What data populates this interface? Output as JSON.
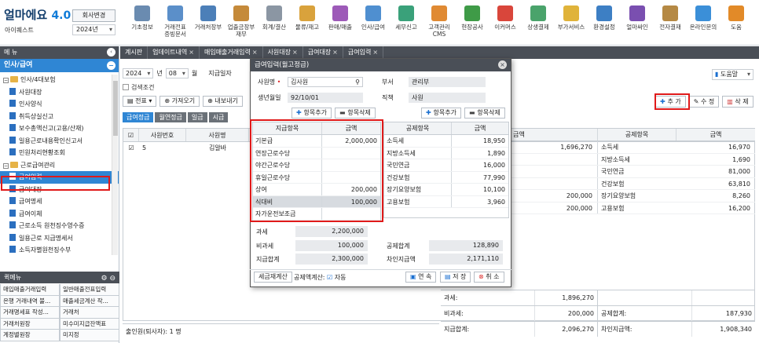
{
  "app": {
    "logo": "얼마에요",
    "version": "4.0",
    "company": "아이퀘스트",
    "company_change": "회사변경",
    "year": "2024년"
  },
  "toolbar": [
    {
      "label": "기초정보",
      "icon": "basic-info-icon",
      "color": "#6a8bb0"
    },
    {
      "label": "거래전표\n증빙문서",
      "icon": "voucher-icon",
      "color": "#5b8fc9"
    },
    {
      "label": "거래처장부",
      "icon": "ledger-icon",
      "color": "#4c7fb8"
    },
    {
      "label": "업출금장부\n재무",
      "icon": "cashbook-icon",
      "color": "#c58a3a"
    },
    {
      "label": "회계/결산",
      "icon": "accounting-icon",
      "color": "#8b96a3"
    },
    {
      "label": "물류/재고",
      "icon": "logistics-icon",
      "color": "#d9a23c"
    },
    {
      "label": "판매/매출",
      "icon": "sales-icon",
      "color": "#9d5ab8"
    },
    {
      "label": "인사/급여",
      "icon": "hr-icon",
      "color": "#4f8fd0"
    },
    {
      "label": "세무신고",
      "icon": "tax-icon",
      "color": "#3aa17a"
    },
    {
      "label": "고객관리\nCMS",
      "icon": "crm-icon",
      "color": "#e08a33"
    },
    {
      "label": "현장공사",
      "icon": "construction-icon",
      "color": "#3f9b47"
    },
    {
      "label": "이커머스",
      "icon": "ecommerce-icon",
      "color": "#d9463b"
    },
    {
      "label": "상생결제",
      "icon": "payment-icon",
      "color": "#4aa36b"
    },
    {
      "label": "부가서비스",
      "icon": "service-icon",
      "color": "#e0b33a"
    },
    {
      "label": "환경설정",
      "icon": "settings-icon",
      "color": "#3d7fc4"
    },
    {
      "label": "얼마싸인",
      "icon": "sign-icon",
      "color": "#7a4fb0"
    },
    {
      "label": "전자결재",
      "icon": "approval-icon",
      "color": "#b58944"
    },
    {
      "label": "온라인문의",
      "icon": "inquiry-icon",
      "color": "#3b8fd8"
    },
    {
      "label": "도움",
      "icon": "help-icon",
      "color": "#e28a28"
    }
  ],
  "sidebar": {
    "menu_header": "메 뉴",
    "section": "인사/급여",
    "items": [
      {
        "label": "인사/4대보험",
        "type": "folder"
      },
      {
        "label": "사원대장",
        "type": "leaf"
      },
      {
        "label": "인사양식",
        "type": "leaf"
      },
      {
        "label": "취득상실신고",
        "type": "leaf"
      },
      {
        "label": "보수총액신고(고용/산재)",
        "type": "leaf"
      },
      {
        "label": "일용근로내용확인신고서",
        "type": "leaf"
      },
      {
        "label": "민원처리현황조회",
        "type": "leaf"
      },
      {
        "label": "근로급여관리",
        "type": "folder"
      },
      {
        "label": "급여입력",
        "type": "leaf",
        "selected": true
      },
      {
        "label": "급여대장",
        "type": "leaf"
      },
      {
        "label": "급여명세",
        "type": "leaf"
      },
      {
        "label": "급여이체",
        "type": "leaf"
      },
      {
        "label": "근로소득 원천징수영수증",
        "type": "leaf"
      },
      {
        "label": "일용근로 지급명세서",
        "type": "leaf"
      },
      {
        "label": "소득자별원천징수부",
        "type": "leaf"
      }
    ],
    "quick_header": "퀵메뉴",
    "quick": [
      "매입매출거래입력",
      "일반매출전표입력",
      "은행 거래내역 불...",
      "매출세금계산 작...",
      "거래명세표 작성...",
      "거래처",
      "거래처원장",
      "미수미지급잔액표",
      "계정별원장",
      "미지정"
    ]
  },
  "tabs": [
    "계시판",
    "업데이트내역",
    "매입매출거래입력",
    "사원대장",
    "급여대장",
    "급여입력"
  ],
  "filter": {
    "year": "2024",
    "year_unit": "년",
    "month": "08",
    "month_unit": "월",
    "paydate_label": "지급일자",
    "search_cond": "검색조건",
    "voucher": "전표",
    "import": "가져오기",
    "export": "내보내기",
    "help": "도움말",
    "add": "추 가",
    "edit": "수 정",
    "delete": "삭 제"
  },
  "subtabs": [
    "급여정급",
    "월연정급",
    "일급",
    "시급"
  ],
  "main_grid": {
    "headers": [
      "사원번호",
      "사원명"
    ],
    "row": {
      "no": "5",
      "name": "김알바"
    }
  },
  "right_table": {
    "headers": [
      "금액",
      "공제항목",
      "금액"
    ],
    "rows": [
      {
        "a": "1,696,270",
        "b": "소득세",
        "c": "16,970"
      },
      {
        "a": "",
        "b": "지방소득세",
        "c": "1,690"
      },
      {
        "a": "",
        "b": "국민연금",
        "c": "81,000"
      },
      {
        "a": "",
        "b": "건강보험",
        "c": "63,810"
      },
      {
        "a": "200,000",
        "b": "장기요양보험",
        "c": "8,260"
      },
      {
        "a": "200,000",
        "b": "고용보험",
        "c": "16,200"
      }
    ]
  },
  "summary": [
    {
      "l1": "과세:",
      "v1": "1,896,270",
      "l2": "",
      "v2": ""
    },
    {
      "l1": "비과세:",
      "v1": "200,000",
      "l2": "공제합계:",
      "v2": "187,930"
    },
    {
      "l1": "지급합계:",
      "v1": "2,096,270",
      "l2": "차인지급액:",
      "v2": "1,908,340"
    }
  ],
  "footer": {
    "retired": "출인원(퇴사자):  1 명"
  },
  "modal": {
    "title": "급여입력(월고정급)",
    "emp_label": "사원명",
    "emp_value": "김사원",
    "dept_label": "부서",
    "dept_value": "관리부",
    "birth_label": "생년월일",
    "birth_value": "92/10/01",
    "position_label": "직책",
    "position_value": "사원",
    "add_item": "항목추가",
    "del_item": "항목삭제",
    "pay_headers": [
      "지급항목",
      "금액"
    ],
    "pay_items": [
      {
        "name": "기본급",
        "value": "2,000,000"
      },
      {
        "name": "연장근로수당",
        "value": ""
      },
      {
        "name": "야간근로수당",
        "value": ""
      },
      {
        "name": "휴일근로수당",
        "value": ""
      },
      {
        "name": "상여",
        "value": "200,000"
      },
      {
        "name": "식대비",
        "value": "100,000",
        "highlight": true
      },
      {
        "name": "자가운전보조금",
        "value": ""
      }
    ],
    "ded_headers": [
      "공제항목",
      "금액"
    ],
    "ded_items": [
      {
        "name": "소득세",
        "value": "18,950"
      },
      {
        "name": "지방소득세",
        "value": "1,890"
      },
      {
        "name": "국민연금",
        "value": "16,000"
      },
      {
        "name": "건강보험",
        "value": "77,990"
      },
      {
        "name": "장기요양보험",
        "value": "10,100"
      },
      {
        "name": "고용보험",
        "value": "3,960"
      }
    ],
    "taxable_label": "과세",
    "taxable_value": "2,200,000",
    "nontax_label": "비과세",
    "nontax_value": "100,000",
    "total_label": "지급합계",
    "total_value": "2,300,000",
    "ded_total_label": "공제합계",
    "ded_total_value": "128,890",
    "net_label": "차인지급액",
    "net_value": "2,171,110",
    "recalc": "세금재계산",
    "auto_label": "공제액계산:",
    "auto_value": "자동",
    "continue": "연 속",
    "save": "저 장",
    "cancel": "취 소"
  }
}
